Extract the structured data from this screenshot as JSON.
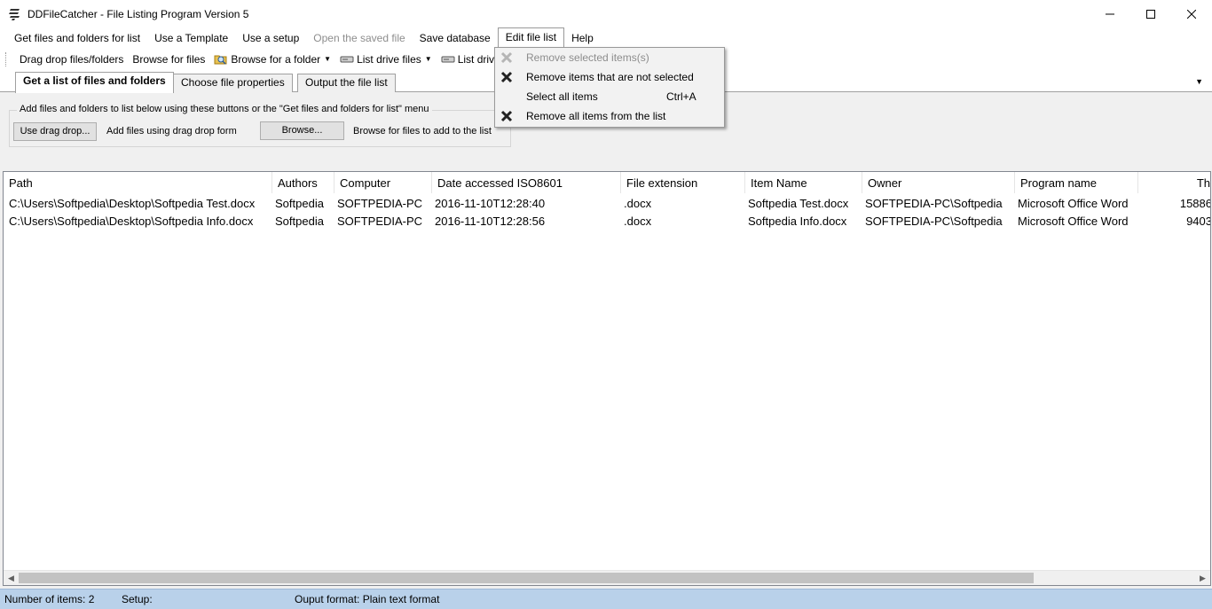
{
  "window": {
    "title": "DDFileCatcher - File Listing Program Version 5"
  },
  "menubar": {
    "items": [
      {
        "label": "Get files and folders for list",
        "disabled": false
      },
      {
        "label": "Use a Template",
        "disabled": false
      },
      {
        "label": "Use a setup",
        "disabled": false
      },
      {
        "label": "Open the saved file",
        "disabled": true
      },
      {
        "label": "Save database",
        "disabled": false
      },
      {
        "label": "Edit file list",
        "disabled": false,
        "open": true
      },
      {
        "label": "Help",
        "disabled": false
      }
    ]
  },
  "toolbar": {
    "drag_drop": "Drag drop files/folders",
    "browse_files": "Browse for files",
    "browse_folder": "Browse for a folder",
    "list_drive_files": "List drive files",
    "list_drive_folders": "List drive fo"
  },
  "tabs": [
    {
      "label": "Get a list of files and folders",
      "active": true
    },
    {
      "label": "Choose file properties",
      "active": false
    },
    {
      "label": "Output the file list",
      "active": false
    }
  ],
  "panel": {
    "group_title": "Add files and folders to list below using these buttons or the \"Get files and folders for list\" menu",
    "drag_button": "Use drag drop...",
    "drag_label": "Add files using drag drop form",
    "browse_button": "Browse...",
    "browse_label": "Browse for files to add to the list"
  },
  "listview": {
    "columns": [
      "Path",
      "Authors",
      "Computer",
      "Date accessed ISO8601",
      "File extension",
      "Item Name",
      "Owner",
      "Program name",
      "Th"
    ],
    "rows": [
      [
        "C:\\Users\\Softpedia\\Desktop\\Softpedia Test.docx",
        "Softpedia",
        "SOFTPEDIA-PC",
        "2016-11-10T12:28:40",
        ".docx",
        "Softpedia Test.docx",
        "SOFTPEDIA-PC\\Softpedia",
        "Microsoft Office Word",
        "15886"
      ],
      [
        "C:\\Users\\Softpedia\\Desktop\\Softpedia Info.docx",
        "Softpedia",
        "SOFTPEDIA-PC",
        "2016-11-10T12:28:56",
        ".docx",
        "Softpedia Info.docx",
        "SOFTPEDIA-PC\\Softpedia",
        "Microsoft Office Word",
        "9403"
      ]
    ]
  },
  "statusbar": {
    "items_count": "Number of items: 2",
    "setup": "Setup:",
    "output_format": "Ouput format: Plain text format"
  },
  "edit_menu": {
    "items": [
      {
        "label": "Remove selected items(s)",
        "disabled": true,
        "icon": "x-icon",
        "shortcut": ""
      },
      {
        "label": "Remove items that are not selected",
        "disabled": false,
        "icon": "x-icon",
        "shortcut": ""
      },
      {
        "label": "Select all items",
        "disabled": false,
        "icon": "",
        "shortcut": "Ctrl+A"
      },
      {
        "label": "Remove all items from the list",
        "disabled": false,
        "icon": "x-icon",
        "shortcut": ""
      }
    ]
  },
  "colors": {
    "statusbar_bg": "#b9d1ea",
    "disabled_text": "#8d8d8d"
  }
}
